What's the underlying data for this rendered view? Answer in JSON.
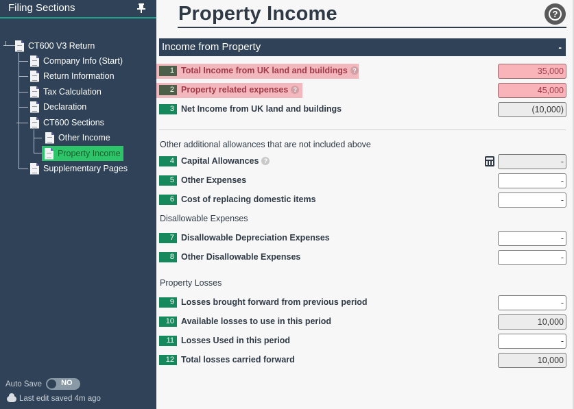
{
  "sidebar": {
    "title": "Filing Sections",
    "expand_glyph": "»",
    "tree": [
      {
        "label": "CT600 V3 Return",
        "icon": "document-icon"
      },
      {
        "label": "Company Info (Start)",
        "icon": "document-icon"
      },
      {
        "label": "Return Information",
        "icon": "document-icon"
      },
      {
        "label": "Tax Calculation",
        "icon": "document-icon"
      },
      {
        "label": "Declaration",
        "icon": "document-icon"
      },
      {
        "label": "CT600 Sections",
        "icon": "document-icon"
      },
      {
        "label": "Other Income",
        "icon": "document-icon"
      },
      {
        "label": "Property Income",
        "icon": "document-icon",
        "active": true
      },
      {
        "label": "Supplementary Pages",
        "icon": "document-icon"
      }
    ],
    "autosave_label": "Auto Save",
    "autosave_state": "NO",
    "last_saved": "Last edit saved 4m ago"
  },
  "page": {
    "title": "Property Income",
    "help_glyph": "?",
    "section_title": "Income from Property",
    "section_toggle": "-"
  },
  "rows": [
    {
      "num": "1",
      "label": "Total Income from UK land and buildings",
      "value": "35,000",
      "error": true,
      "help": true
    },
    {
      "num": "2",
      "label": "Property related expenses",
      "value": "45,000",
      "error": true,
      "help": true
    },
    {
      "num": "3",
      "label": "Net Income from UK land and buildings",
      "value": "(10,000)",
      "readonly": true
    },
    {
      "num": "4",
      "label": "Capital Allowances",
      "value": "-",
      "readonly": true,
      "help": true,
      "calculator": true
    },
    {
      "num": "5",
      "label": "Other Expenses",
      "value": "-"
    },
    {
      "num": "6",
      "label": "Cost of replacing domestic items",
      "value": "-"
    },
    {
      "num": "7",
      "label": "Disallowable Depreciation Expenses",
      "value": "-"
    },
    {
      "num": "8",
      "label": "Other Disallowable Expenses",
      "value": "-"
    },
    {
      "num": "9",
      "label": "Losses brought forward from previous period",
      "value": "-"
    },
    {
      "num": "10",
      "label": "Available losses to use in this period",
      "value": "10,000",
      "readonly": true
    },
    {
      "num": "11",
      "label": "Losses Used in this period",
      "value": "-"
    },
    {
      "num": "12",
      "label": "Total losses carried forward",
      "value": "10,000",
      "readonly": true
    }
  ],
  "subheadings": {
    "other_allowances": "Other additional allowances that are not included above",
    "disallowable": "Disallowable Expenses",
    "losses": "Property Losses"
  },
  "colors": {
    "sidebar_bg": "#2f4257",
    "accent_green": "#15895c",
    "active_item": "#2ec46a",
    "error_bg": "#f3b8bd"
  }
}
